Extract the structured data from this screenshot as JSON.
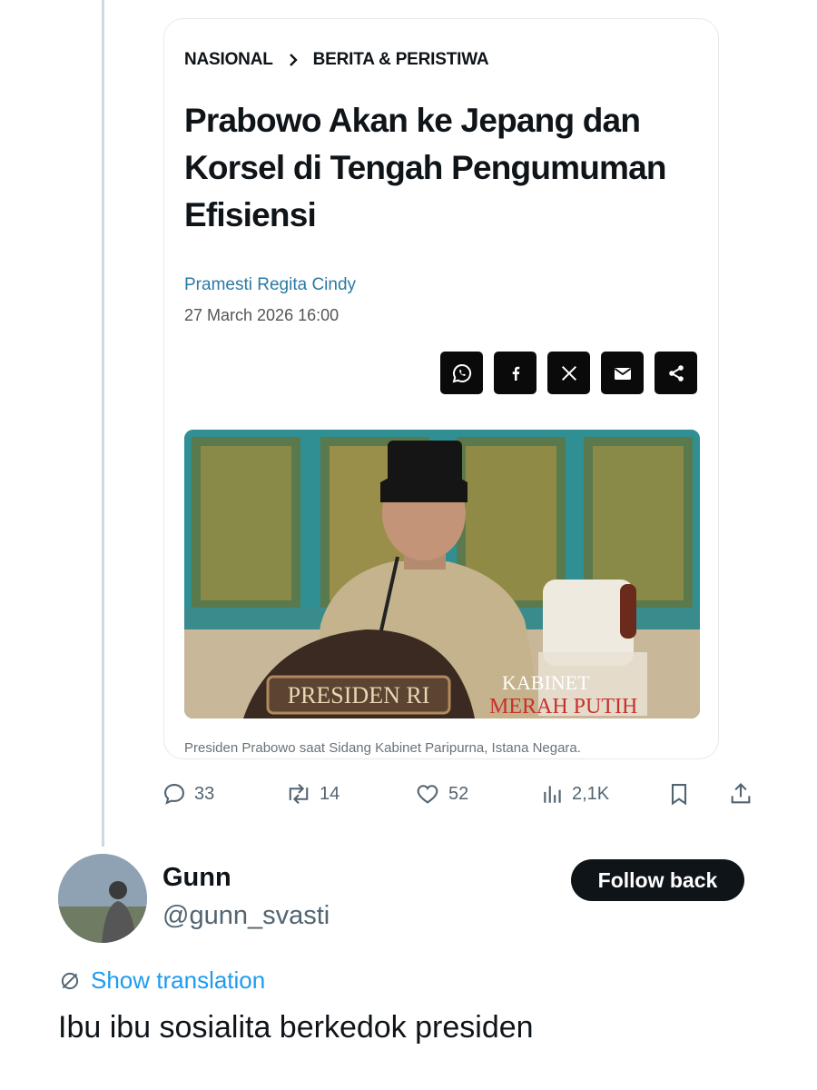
{
  "article": {
    "breadcrumb": [
      "NASIONAL",
      "BERITA & PERISTIWA"
    ],
    "headline": "Prabowo Akan ke Jepang dan Korsel di Tengah Pengumuman Efisiensi",
    "author": "Pramesti Regita Cindy",
    "date": "27 March 2026 16:00",
    "share_icons": [
      "whatsapp-icon",
      "facebook-icon",
      "x-icon",
      "mail-icon",
      "share-icon"
    ],
    "photo": {
      "nameplate": "PRESIDEN RI",
      "watermark_line1": "KABINET",
      "watermark_line2": "MERAH PUTIH"
    },
    "caption": "Presiden Prabowo saat Sidang Kabinet Paripurna, Istana Negara."
  },
  "actions": {
    "replies": "33",
    "reposts": "14",
    "likes": "52",
    "views": "2,1K"
  },
  "reply": {
    "name": "Gunn",
    "handle": "@gunn_svasti",
    "follow_label": "Follow back",
    "translation_label": "Show translation",
    "text": "Ibu ibu sosialita berkedok presiden"
  },
  "colors": {
    "accent_blue": "#1d9bf0",
    "author_link": "#2a7aa3",
    "muted": "#536471"
  }
}
